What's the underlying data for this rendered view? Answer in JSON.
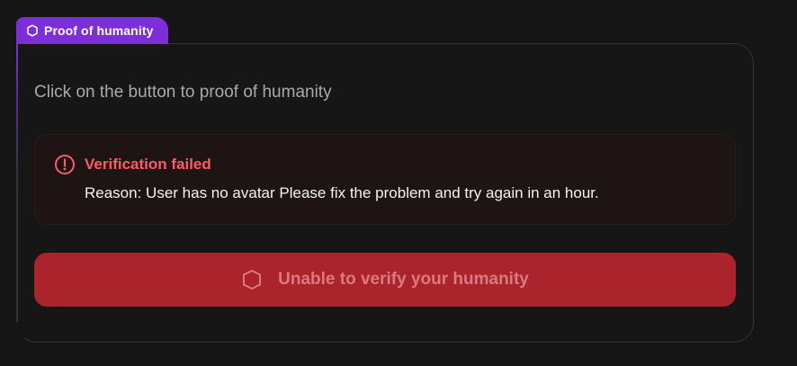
{
  "tab": {
    "label": "Proof of humanity",
    "icon": "shield-icon"
  },
  "card": {
    "instruction": "Click on the button to proof of humanity"
  },
  "alert": {
    "icon": "alert-circle-icon",
    "title": "Verification failed",
    "reason": "Reason: User has no avatar Please fix the problem and try again in an hour."
  },
  "button": {
    "icon": "shield-icon",
    "label": "Unable to verify your humanity",
    "state": "disabled"
  },
  "colors": {
    "accent": "#7c2fd8",
    "background": "#151515",
    "error_text": "#ff5a66",
    "button_background": "#ab232b",
    "button_text": "#d97a80"
  }
}
